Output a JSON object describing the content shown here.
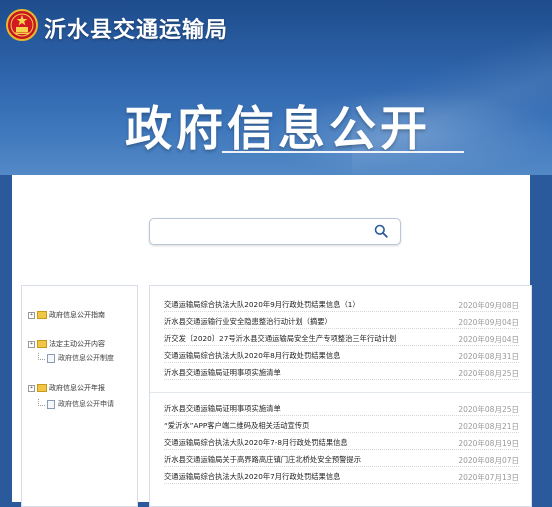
{
  "header": {
    "site_title": "沂水县交通运输局",
    "page_title": "政府信息公开"
  },
  "search": {
    "value": "",
    "placeholder": ""
  },
  "sidebar": {
    "items": [
      {
        "label": "政府信息公开指南",
        "level": 0
      },
      {
        "label": "法定主动公开内容",
        "level": 0
      },
      {
        "label": "政府信息公开制度",
        "level": 1
      },
      {
        "label": "政府信息公开年报",
        "level": 0
      },
      {
        "label": "政府信息公开申请",
        "level": 1
      }
    ]
  },
  "list": {
    "group1": [
      {
        "title": "交通运输局综合执法大队2020年9月行政处罚结果信息（1）",
        "date": "2020年09月08日"
      },
      {
        "title": "沂水县交通运输行业安全隐患整治行动计划（摘要）",
        "date": "2020年09月04日"
      },
      {
        "title": "沂交发〔2020〕27号沂水县交通运输局安全生产专项整治三年行动计划",
        "date": "2020年09月04日"
      },
      {
        "title": "交通运输局综合执法大队2020年8月行政处罚结果信息",
        "date": "2020年08月31日"
      },
      {
        "title": "沂水县交通运输局证明事项实施清单",
        "date": "2020年08月25日"
      }
    ],
    "group2": [
      {
        "title": "沂水县交通运输局证明事项实施清单",
        "date": "2020年08月25日"
      },
      {
        "title": "“爱沂水”APP客户端二维码及相关活动宣传页",
        "date": "2020年08月21日"
      },
      {
        "title": "交通运输局综合执法大队2020年7-8月行政处罚结果信息",
        "date": "2020年08月19日"
      },
      {
        "title": "沂水县交通运输局关于高界路高庄镇门庄北桥处安全预警提示",
        "date": "2020年08月07日"
      },
      {
        "title": "交通运输局综合执法大队2020年7月行政处罚结果信息",
        "date": "2020年07月13日"
      }
    ]
  },
  "colors": {
    "banner": "#2f66ad",
    "accent_gold": "#f1c644",
    "date_text": "#999999"
  }
}
